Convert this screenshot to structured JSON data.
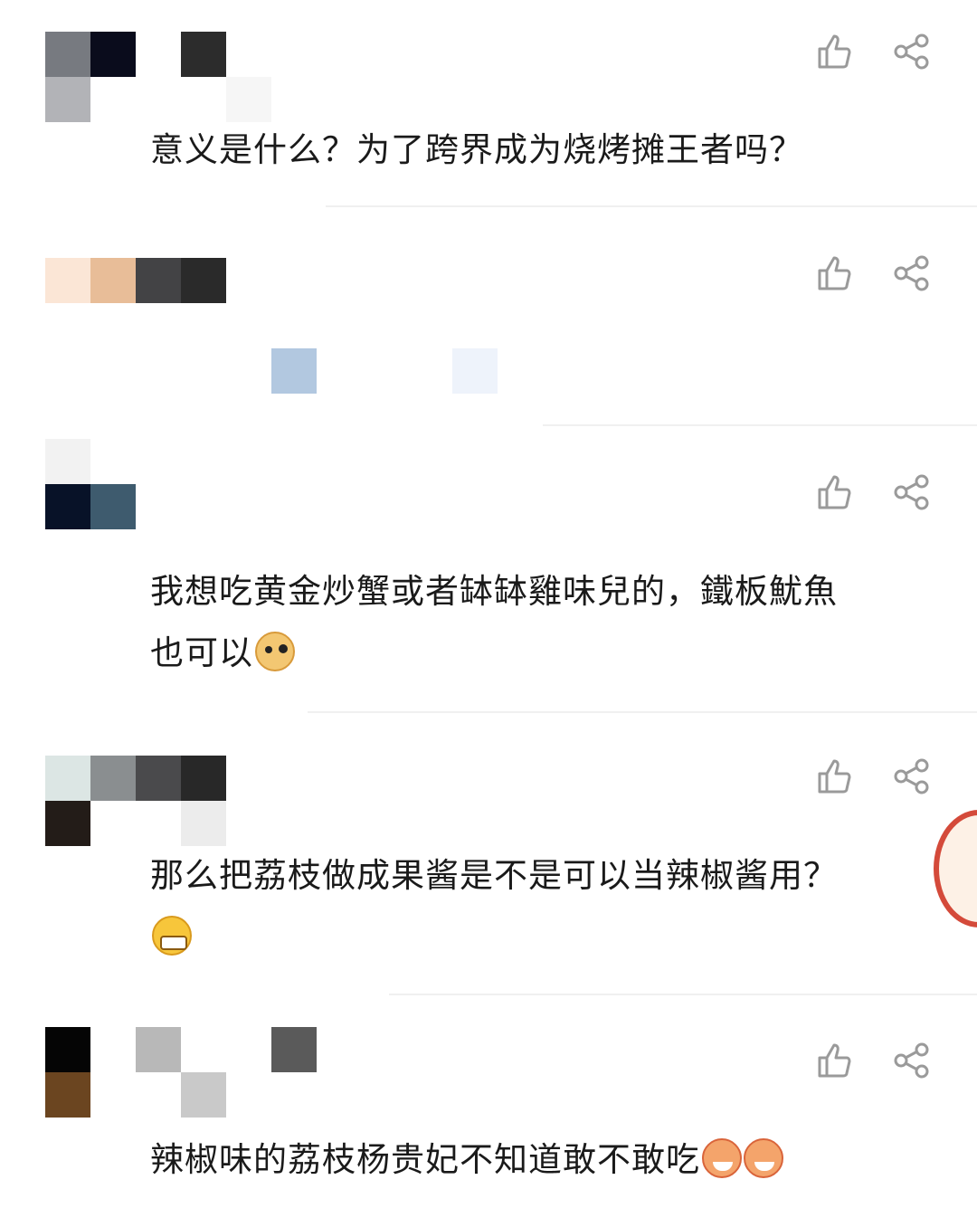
{
  "comments": [
    {
      "text": "意义是什么？为了跨界成为烧烤摊王者吗？"
    },
    {
      "text": ""
    },
    {
      "text": "我想吃黄金炒蟹或者缽缽雞味兒的，鐵板魷魚\n也可以",
      "emoji": "doge-emoji"
    },
    {
      "text": "那么把荔枝做成果酱是不是可以当辣椒酱用？",
      "emoji": "grin-emoji"
    },
    {
      "text": "辣椒味的荔枝杨贵妃不知道敢不敢吃",
      "emoji": "shrimp-emoji"
    }
  ],
  "icons": {
    "like": "thumbs-up-icon",
    "share": "share-icon"
  },
  "colors": {
    "icon": "#9a9a9a",
    "text": "#1a1a1a",
    "divider": "#f0f0f0"
  }
}
